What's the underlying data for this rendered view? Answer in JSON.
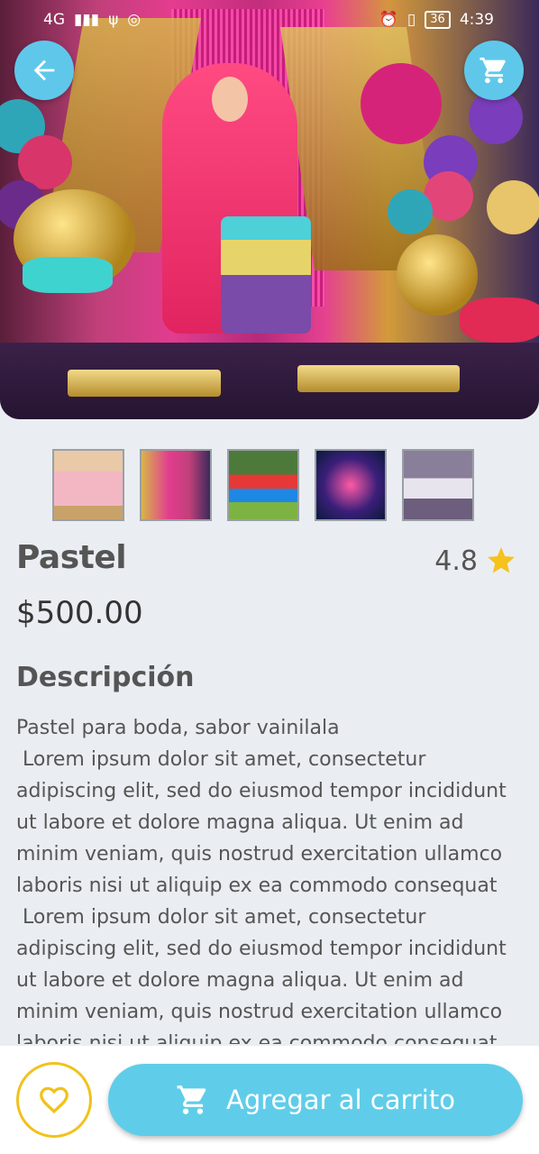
{
  "status_bar": {
    "network": "4G",
    "battery": "36",
    "time": "4:39"
  },
  "product": {
    "title": "Pastel",
    "rating": "4.8",
    "price": "$500.00",
    "description_heading": "Descripción",
    "description": "Pastel para boda, sabor vainilala\n Lorem ipsum dolor sit amet, consectetur adipiscing elit, sed do eiusmod tempor incididunt ut labore et dolore magna aliqua. Ut enim ad minim veniam, quis nostrud exercitation ullamco laboris nisi ut aliquip ex ea commodo consequat\n Lorem ipsum dolor sit amet, consectetur adipiscing elit, sed do eiusmod tempor incididunt ut labore et dolore magna aliqua. Ut enim ad minim veniam, quis nostrud exercitation ullamco laboris nisi ut aliquip ex ea commodo consequat"
  },
  "actions": {
    "add_to_cart_label": "Agregar al carrito"
  },
  "icons": {
    "back": "arrow-left-icon",
    "cart": "cart-icon",
    "favorite": "heart-icon",
    "rating": "star-icon"
  },
  "colors": {
    "accent": "#5fcde9",
    "favorite": "#f1c21b",
    "star": "#f6c21c"
  }
}
